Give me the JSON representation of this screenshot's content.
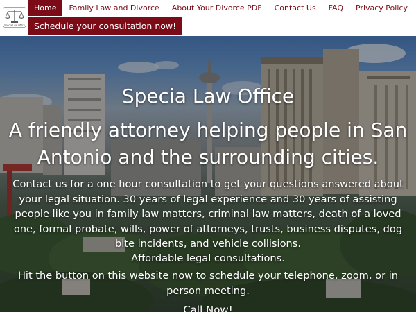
{
  "brand": {
    "logo_icon": "scales-of-justice-icon",
    "logo_text": "Specia Law Office",
    "accent_color": "#7b0b17"
  },
  "nav": {
    "items": [
      {
        "label": "Home",
        "active": true
      },
      {
        "label": "Family Law and Divorce",
        "active": false
      },
      {
        "label": "About Your Divorce PDF",
        "active": false
      },
      {
        "label": "Contact Us",
        "active": false
      },
      {
        "label": "FAQ",
        "active": false
      },
      {
        "label": "Privacy Policy",
        "active": false
      }
    ]
  },
  "cta_top": {
    "label": "Schedule your consultation now!"
  },
  "hero": {
    "title": "Specia Law Office",
    "tagline": "A friendly attorney helping people in San Antonio and the surrounding cities.",
    "description": "Contact us for a one hour consultation to get your questions answered about your legal situation. 30 years of legal experience and 30 years of assisting people like you in family law matters, criminal law matters, death of a loved one, formal probate, wills, power of attorneys, trusts, business disputes, dog bite incidents, and vehicle collisions.",
    "affordable": "Affordable legal consultations.",
    "schedule": "Hit the button on this website now to schedule your telephone, zoom, or in person meeting.",
    "call_label": "Call Now!"
  }
}
